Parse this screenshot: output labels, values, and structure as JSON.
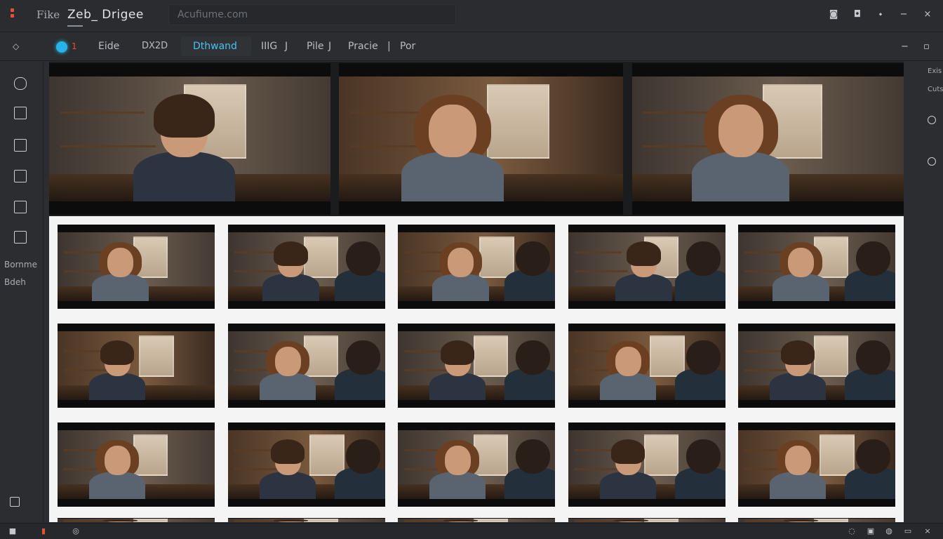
{
  "titlebar": {
    "file_menu": "Fike",
    "title": "Zeb_ Drigee",
    "search_placeholder": "Acufiume.com",
    "right_icons": [
      "camera-icon",
      "shield-icon",
      "share-icon",
      "minimize-icon",
      "close-icon"
    ]
  },
  "toolbar": {
    "rec_count": "1",
    "items": [
      "Eide",
      "DX2D",
      "Dthwand",
      "IIIG",
      "Pile",
      "Pracie",
      "Por"
    ],
    "seps": [
      "J",
      "J",
      "|"
    ],
    "active": "Dthwand",
    "right_icons": [
      "collapse-icon",
      "close-icon"
    ]
  },
  "sidebar": {
    "icons": [
      "note-icon",
      "layout-icon",
      "filter-icon",
      "clip-icon",
      "monitor-icon",
      "crop-icon"
    ],
    "labels": [
      "Bornme",
      "Bdeh"
    ],
    "bottom_icon": "expand-icon"
  },
  "right_panel": {
    "labels": [
      "Exis",
      "Cuts"
    ],
    "icons": [
      "refresh-icon",
      "clock-icon"
    ]
  },
  "colors": {
    "accent": "#27b3ea",
    "record": "#27b3ea",
    "title_dot": "#e2542f"
  },
  "statusbar": {
    "left_icons": [
      "stop-icon",
      "bar-icon",
      "settings-icon"
    ],
    "right_icons": [
      "cloud-icon",
      "save-icon",
      "link-icon",
      "window-icon",
      "close-icon"
    ]
  }
}
